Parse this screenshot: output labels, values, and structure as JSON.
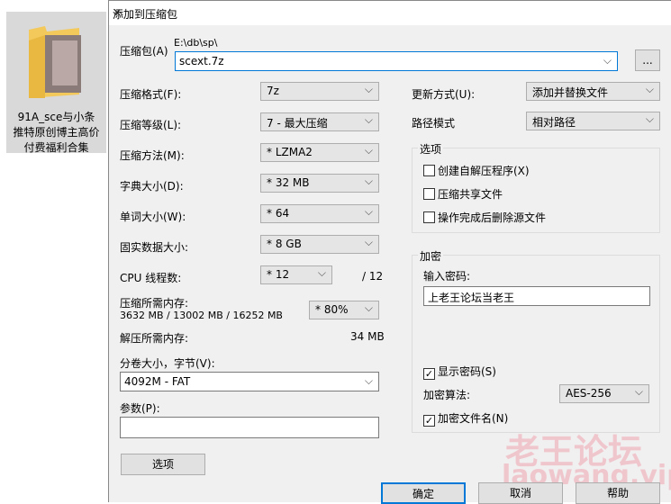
{
  "desktop": {
    "folder_name_lines": [
      "91A_sce与小条",
      "推特原创博主高价",
      "付费福利合集"
    ]
  },
  "dialog": {
    "title": "添加到压缩包",
    "archive_label": "压缩包(A)",
    "archive_path": "E:\\db\\sp\\",
    "archive_name": "scext.7z",
    "browse_label": "...",
    "format_label": "压缩格式(F):",
    "format_value": "7z",
    "level_label": "压缩等级(L):",
    "level_value": "7 - 最大压缩",
    "method_label": "压缩方法(M):",
    "method_value": "* LZMA2",
    "dict_label": "字典大小(D):",
    "dict_value": "* 32 MB",
    "word_label": "单词大小(W):",
    "word_value": "* 64",
    "solid_label": "固实数据大小:",
    "solid_value": "* 8 GB",
    "cpu_label": "CPU 线程数:",
    "cpu_value": "* 12",
    "cpu_total": "/ 12",
    "mem_label": "压缩所需内存:",
    "mem_value": "3632 MB / 13002 MB / 16252 MB",
    "mem_pct": "* 80%",
    "decomp_label": "解压所需内存:",
    "decomp_value": "34 MB",
    "split_label": "分卷大小，字节(V):",
    "split_value": "4092M - FAT",
    "params_label": "参数(P):",
    "params_value": "",
    "options_button": "选项",
    "update_label": "更新方式(U):",
    "update_value": "添加并替换文件",
    "path_label": "路径模式",
    "path_value": "相对路径",
    "options_group": "选项",
    "opt_sfx": "创建自解压程序(X)",
    "opt_shared": "压缩共享文件",
    "opt_delete": "操作完成后删除源文件",
    "enc_group": "加密",
    "pwd_label": "输入密码:",
    "pwd_value": "上老王论坛当老王",
    "show_pwd": "显示密码(S)",
    "enc_method_label": "加密算法:",
    "enc_method_value": "AES-256",
    "enc_names": "加密文件名(N)",
    "ok": "确定",
    "cancel": "取消",
    "help": "帮助"
  },
  "watermark": {
    "cn": "老王论坛",
    "en": "laowang.vip"
  }
}
